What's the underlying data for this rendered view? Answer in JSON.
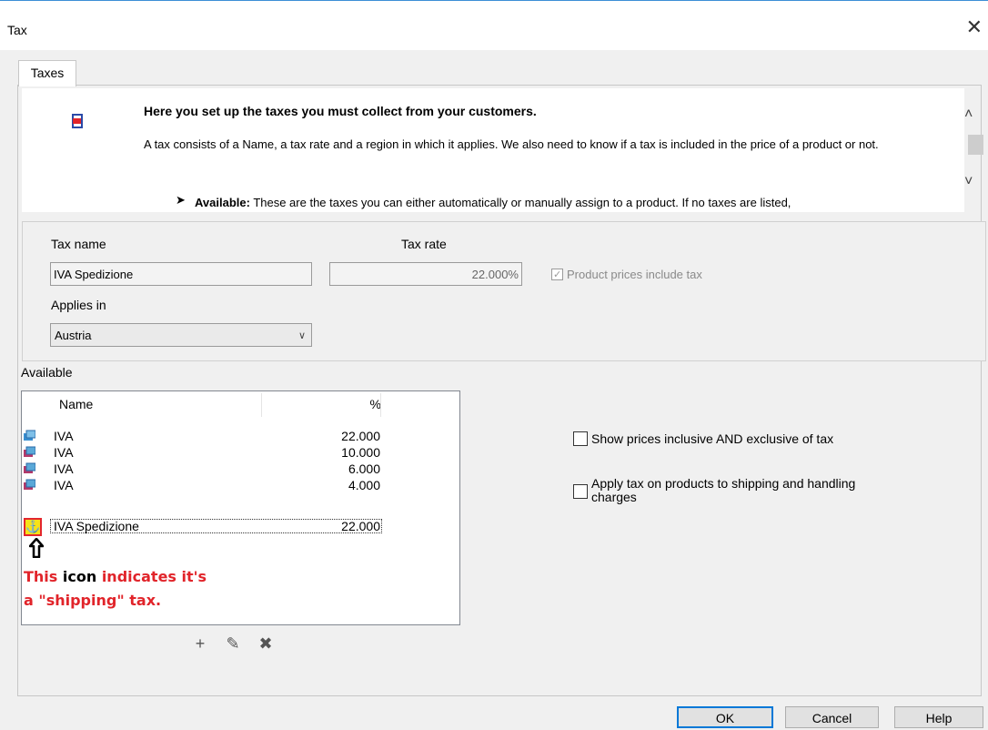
{
  "window": {
    "title": "Tax",
    "close_glyph": "✕"
  },
  "tabs": [
    {
      "label": "Taxes"
    }
  ],
  "help": {
    "heading": "Here you set up the taxes you must collect from your customers.",
    "description": "A tax consists of a Name, a tax rate and a region in which it applies. We also need to know if a tax is included in the price of a product or not.",
    "bullet_bold": "Available:",
    "bullet_text": " These are the taxes you can either automatically or manually assign to a product.  If no taxes are listed,"
  },
  "form": {
    "tax_name_label": "Tax name",
    "tax_name_value": "IVA Spedizione",
    "tax_rate_label": "Tax rate",
    "tax_rate_value": "22.000%",
    "prices_include_tax_label": "Product prices include tax",
    "prices_include_tax_checked": true,
    "applies_in_label": "Applies in",
    "applies_in_value": "Austria"
  },
  "available": {
    "label": "Available",
    "columns": {
      "name": "Name",
      "pct": "%"
    },
    "rows": [
      {
        "name": "IVA",
        "pct": "22.000",
        "icon": "tax-default-icon"
      },
      {
        "name": "IVA",
        "pct": "10.000",
        "icon": "tax-icon"
      },
      {
        "name": "IVA",
        "pct": "6.000",
        "icon": "tax-icon"
      },
      {
        "name": "IVA",
        "pct": "4.000",
        "icon": "tax-icon"
      },
      {
        "name": "IVA Spedizione",
        "pct": "22.000",
        "icon": "shipping-tax-icon"
      }
    ]
  },
  "annotation": {
    "line1_a": "This ",
    "line1_b": "icon",
    "line1_c": " indicates it's",
    "line2": "a \"shipping\" tax."
  },
  "tools": {
    "add": "+",
    "edit": "✎",
    "delete": "✖"
  },
  "options": {
    "show_prices_label": "Show prices inclusive AND exclusive of tax",
    "apply_tax_label": "Apply tax on products to shipping and handling charges"
  },
  "buttons": {
    "ok": "OK",
    "cancel": "Cancel",
    "help": "Help"
  }
}
